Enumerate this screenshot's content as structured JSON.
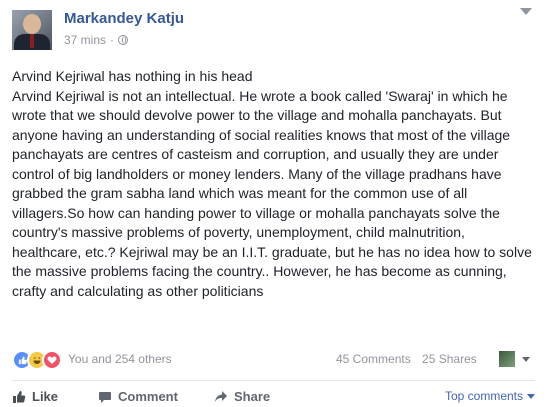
{
  "post": {
    "author": "Markandey Katju",
    "time": "37 mins",
    "separator": "·",
    "body_lines": [
      "Arvind Kejriwal has nothing in his head",
      "Arvind Kejriwal is not an intellectual. He wrote a book called 'Swaraj' in which he wrote that we should devolve power to the village and mohalla panchayats. But anyone having an understanding of social realities knows that most of the village panchayats are centres of casteism and corruption, and usually they are under control of big landholders or money lenders. Many of the village pradhans have grabbed the gram sabha land which was meant for the common use of all villagers.So how can handing power to village or mohalla panchayats solve the country's massive problems of poverty, unemployment, child malnutrition, healthcare, etc.? Kejriwal may be an I.I.T. graduate, but he has no idea how to solve the massive problems facing the country.. However, he has become as cunning, crafty and calculating as other politicians"
    ]
  },
  "engagement": {
    "reactions_text": "You and 254 others",
    "comments": "45 Comments",
    "shares": "25 Shares"
  },
  "actions": {
    "like": "Like",
    "comment": "Comment",
    "share": "Share",
    "sort": "Top comments"
  },
  "colors": {
    "link_blue": "#365899",
    "meta_gray": "#90949c",
    "like_blue": "#5890ff",
    "love_red": "#f25268",
    "haha_yellow": "#f7c846"
  }
}
